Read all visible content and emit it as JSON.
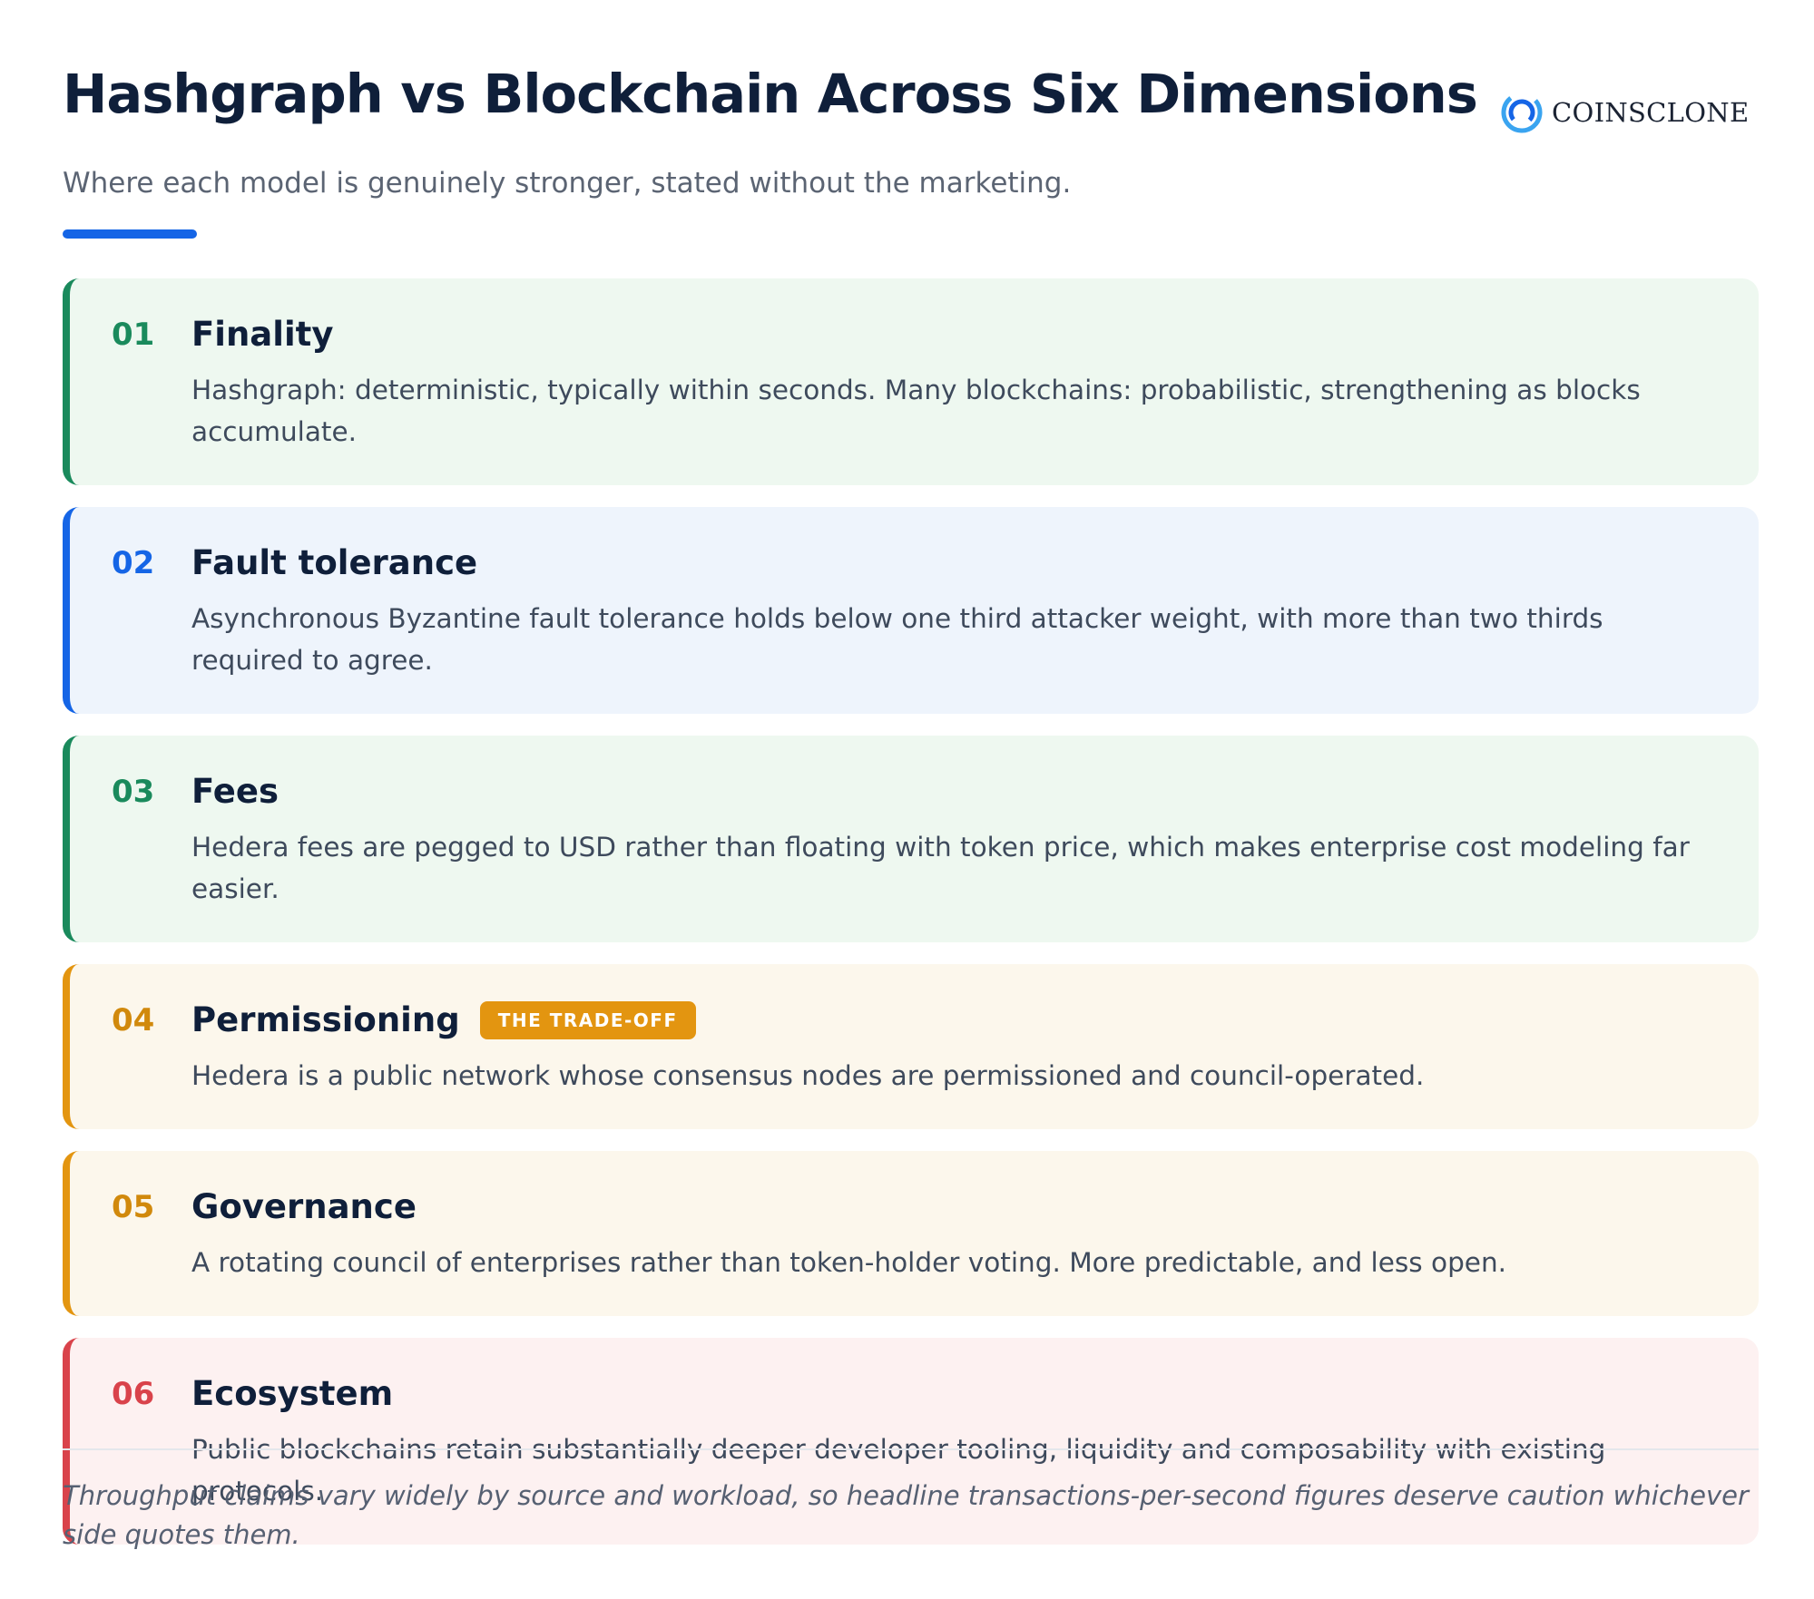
{
  "header": {
    "title": "Hashgraph vs Blockchain Across Six Dimensions",
    "subtitle": "Where each model is genuinely stronger, stated without the marketing.",
    "logo_icon": "coinsclone-logo-icon",
    "logo_text": "COINSCLONE"
  },
  "colors": {
    "green": "#1a8a5c",
    "blue": "#1565e6",
    "amber": "#e39510",
    "red": "#d9434b",
    "title": "#0f1f3a"
  },
  "dimensions": [
    {
      "number": "01",
      "title": "Finality",
      "description": "Hashgraph: deterministic, typically within seconds. Many blockchains: probabilistic, strengthening as blocks accumulate.",
      "tone": "green"
    },
    {
      "number": "02",
      "title": "Fault tolerance",
      "description": "Asynchronous Byzantine fault tolerance holds below one third attacker weight, with more than two thirds required to agree.",
      "tone": "blue"
    },
    {
      "number": "03",
      "title": "Fees",
      "description": "Hedera fees are pegged to USD rather than floating with token price, which makes enterprise cost modeling far easier.",
      "tone": "green"
    },
    {
      "number": "04",
      "title": "Permissioning",
      "badge": "THE TRADE-OFF",
      "description": "Hedera is a public network whose consensus nodes are permissioned and council-operated.",
      "tone": "amber"
    },
    {
      "number": "05",
      "title": "Governance",
      "description": "A rotating council of enterprises rather than token-holder voting. More predictable, and less open.",
      "tone": "amber"
    },
    {
      "number": "06",
      "title": "Ecosystem",
      "description": "Public blockchains retain substantially deeper developer tooling, liquidity and composability with existing protocols.",
      "tone": "red"
    }
  ],
  "footer": {
    "note": "Throughput claims vary widely by source and workload, so headline transactions-per-second figures deserve caution whichever side quotes them."
  }
}
